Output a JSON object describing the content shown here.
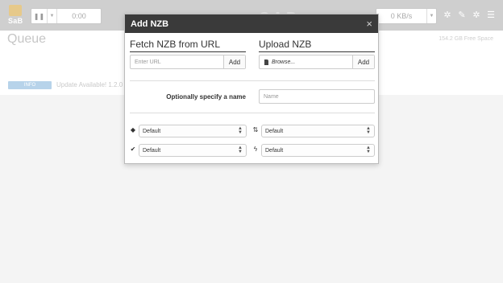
{
  "navbar": {
    "logo_text": "SaB",
    "time": "0:00",
    "speed": "0 KB/s",
    "icons": [
      "pause-icon",
      "chevron-down-icon",
      "gear-icon",
      "wrench-icon",
      "cog-icon",
      "menu-icon"
    ]
  },
  "queue": {
    "title": "Queue",
    "free_space": "154.2 GB Free Space",
    "info_badge": "INFO",
    "update_text": "Update Available! 1.2.0"
  },
  "modal": {
    "title": "Add NZB",
    "close_label": "×",
    "fetch": {
      "title": "Fetch NZB from URL",
      "url_placeholder": "Enter URL",
      "add_label": "Add"
    },
    "upload": {
      "title": "Upload NZB",
      "browse_label": "Browse...",
      "add_label": "Add"
    },
    "name": {
      "label": "Optionally specify a name",
      "placeholder": "Name"
    },
    "selects": {
      "category": "Default",
      "priority": "Default",
      "postprocessing": "Default",
      "script": "Default"
    }
  },
  "colors": {
    "header_bg": "#3a3a3a",
    "navbar_bg": "#cfcfcf",
    "info_badge_bg": "#b7d3ea"
  }
}
